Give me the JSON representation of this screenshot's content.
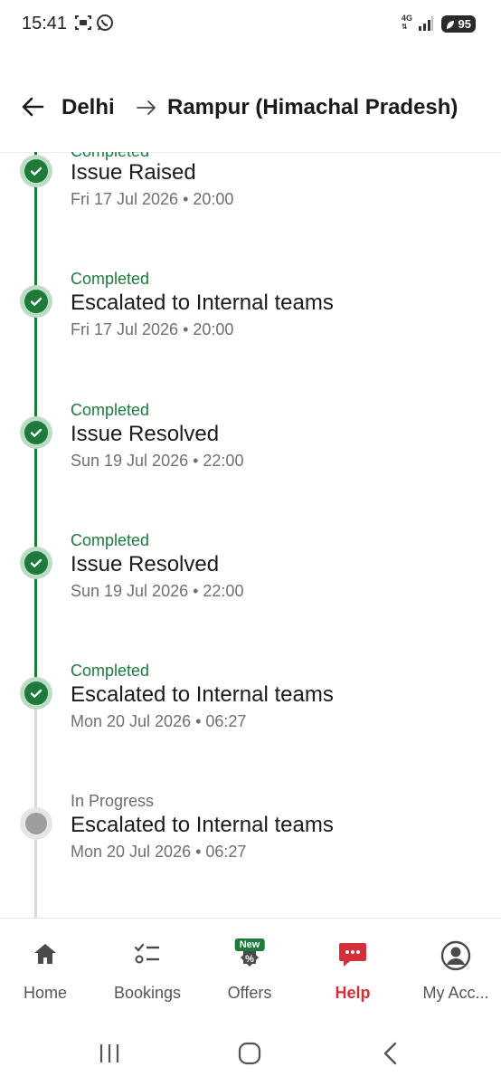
{
  "status_bar": {
    "time": "15:41",
    "network": "4G",
    "battery": "95"
  },
  "header": {
    "origin": "Delhi",
    "destination": "Rampur (Himachal Pradesh)"
  },
  "timeline": [
    {
      "status": "Completed",
      "title": "Issue Raised",
      "date": "Fri 17 Jul 2026 • 20:00",
      "state": "done"
    },
    {
      "status": "Completed",
      "title": "Escalated to Internal teams",
      "date": "Fri 17 Jul 2026 • 20:00",
      "state": "done"
    },
    {
      "status": "Completed",
      "title": "Issue Resolved",
      "date": "Sun 19 Jul 2026 • 22:00",
      "state": "done"
    },
    {
      "status": "Completed",
      "title": "Issue Resolved",
      "date": "Sun 19 Jul 2026 • 22:00",
      "state": "done"
    },
    {
      "status": "Completed",
      "title": "Escalated to Internal teams",
      "date": "Mon 20 Jul 2026 • 06:27",
      "state": "done"
    },
    {
      "status": "In Progress",
      "title": "Escalated to Internal teams",
      "date": "Mon 20 Jul 2026 • 06:27",
      "state": "pending"
    }
  ],
  "bottom_nav": {
    "items": [
      {
        "label": "Home",
        "icon": "home-icon"
      },
      {
        "label": "Bookings",
        "icon": "bookings-icon"
      },
      {
        "label": "Offers",
        "icon": "offers-icon",
        "badge": "New"
      },
      {
        "label": "Help",
        "icon": "help-chat-icon",
        "active": true
      },
      {
        "label": "My Acc...",
        "icon": "account-icon"
      }
    ]
  },
  "colors": {
    "accent_green": "#1d7a3a",
    "active_red": "#d32f3b",
    "pending_grey": "#9e9e9e"
  }
}
